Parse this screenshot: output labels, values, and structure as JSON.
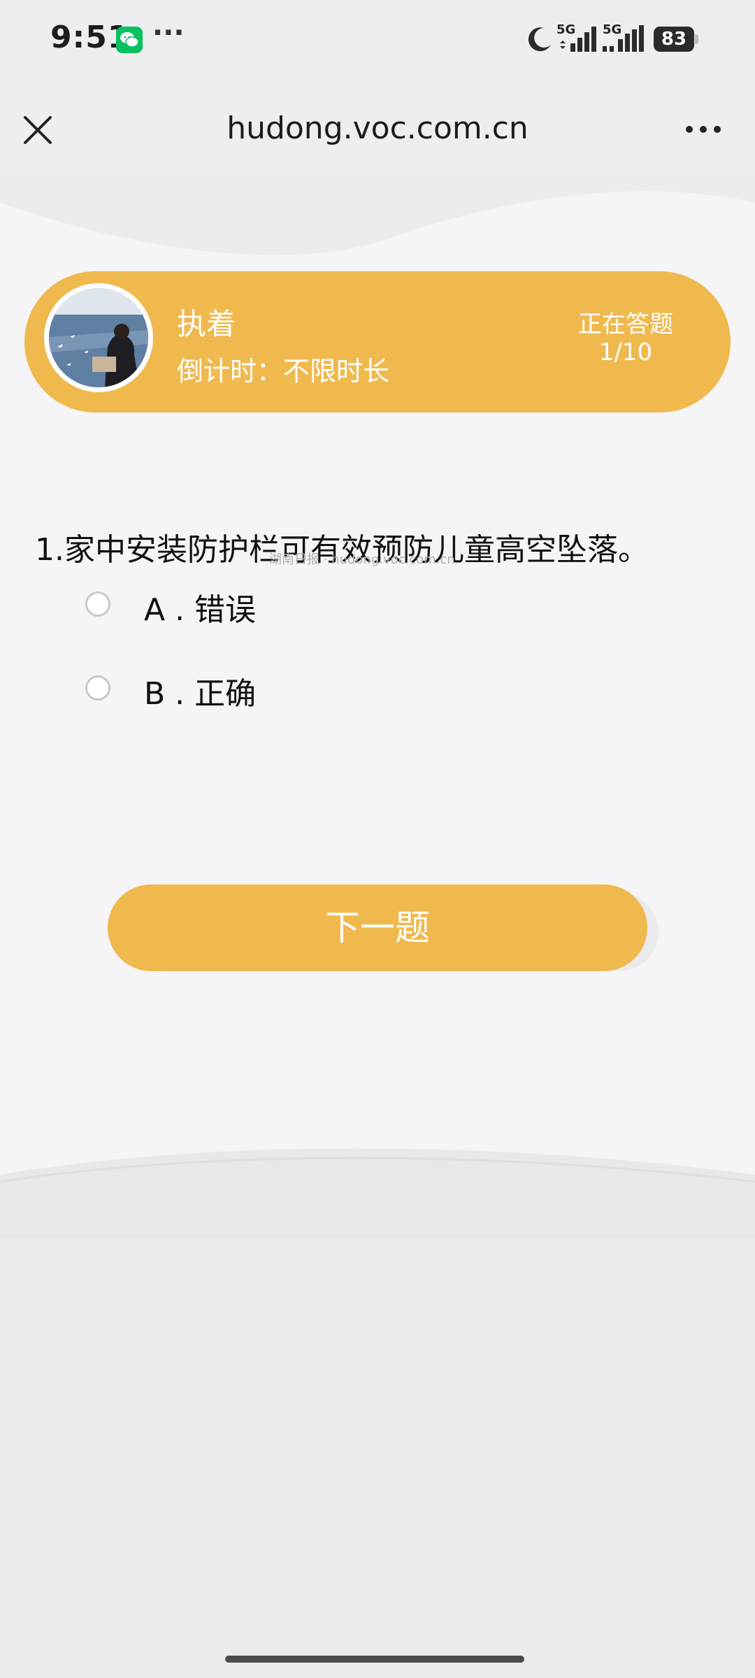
{
  "status_bar": {
    "time": "9:51",
    "more_dots": "···",
    "network_1": "5G",
    "network_2": "5G",
    "battery": "83"
  },
  "browser": {
    "url": "hudong.voc.com.cn"
  },
  "profile": {
    "name": "执着",
    "countdown": "倒计时：不限时长",
    "status": "正在答题",
    "progress": "1/10"
  },
  "quiz": {
    "question": "1.家中安装防护栏可有效预防儿童高空坠落。",
    "watermark": "湖南日报 · hudong.voc.com.cn",
    "options": [
      {
        "label": "A . 错误",
        "selected": false
      },
      {
        "label": "B . 正确",
        "selected": false
      }
    ],
    "next_label": "下一题"
  },
  "colors": {
    "accent": "#f0b94e",
    "background": "#f5f4f6",
    "wechat": "#07c160"
  },
  "icons": {
    "close": "close-icon",
    "more": "more-horizontal-icon",
    "moon": "moon-icon",
    "signal": "signal-icon",
    "wechat": "wechat-icon"
  }
}
